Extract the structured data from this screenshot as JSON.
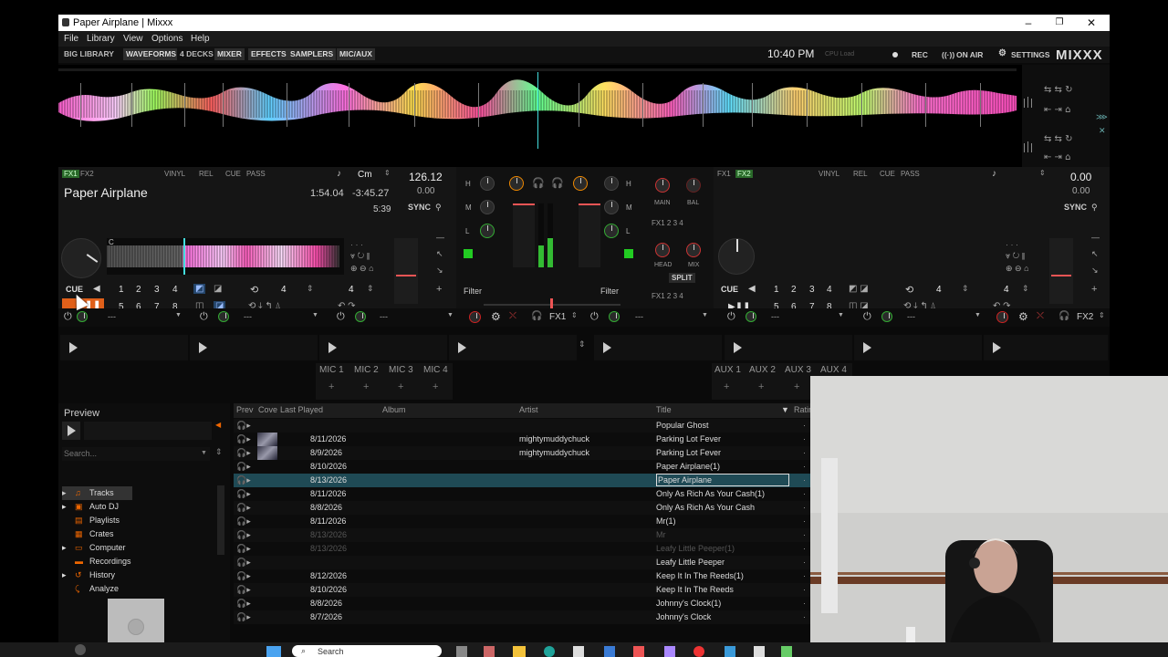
{
  "window": {
    "title": "Paper Airplane | Mixxx",
    "minimize": "–",
    "maximize": "❐",
    "close": "✕"
  },
  "menu": [
    "File",
    "Library",
    "View",
    "Options",
    "Help"
  ],
  "topbar": {
    "buttons": [
      "BIG LIBRARY",
      "WAVEFORMS",
      "4 DECKS",
      "MIXER",
      "EFFECTS",
      "SAMPLERS",
      "MIC/AUX"
    ],
    "clock": "10:40 PM",
    "cpu": "CPU Load",
    "rec": "REC",
    "on_air": "ON AIR",
    "settings": "SETTINGS",
    "logo": "MIXXX"
  },
  "deck1": {
    "fx1": "FX1",
    "fx2": "FX2",
    "vinyl": "VINYL",
    "rel": "REL",
    "cue_mode": "CUE",
    "pass": "PASS",
    "key": "Cm",
    "title": "Paper Airplane",
    "bpm": "126.12",
    "rate": "0.00",
    "elapsed": "1:54.04",
    "remaining": "-3:45.27",
    "duration": "5:39",
    "sync": "SYNC",
    "cue": "CUE",
    "hotcues": [
      "1",
      "2",
      "3",
      "4",
      "5",
      "6",
      "7",
      "8"
    ],
    "loop_size": "4",
    "beatjump": "4",
    "marker": "C"
  },
  "deck2": {
    "fx1": "FX1",
    "fx2": "FX2",
    "vinyl": "VINYL",
    "rel": "REL",
    "cue_mode": "CUE",
    "pass": "PASS",
    "bpm": "0.00",
    "rate": "0.00",
    "sync": "SYNC",
    "cue": "CUE",
    "hotcues": [
      "1",
      "2",
      "3",
      "4",
      "5",
      "6",
      "7",
      "8"
    ],
    "loop_size": "4",
    "beatjump": "4"
  },
  "mixer": {
    "eq": [
      "H",
      "M",
      "L"
    ],
    "filter": "Filter",
    "main": "MAIN",
    "bal": "BAL",
    "head": "HEAD",
    "mix": "MIX",
    "split": "SPLIT",
    "fx_units": [
      "FX1",
      "2",
      "3",
      "4"
    ]
  },
  "effects": {
    "unit1": "FX1",
    "unit2": "FX2",
    "slot_value": "---"
  },
  "mics": [
    "MIC 1",
    "MIC 2",
    "MIC 3",
    "MIC 4"
  ],
  "aux": [
    "AUX 1",
    "AUX 2",
    "AUX 3",
    "AUX 4"
  ],
  "library": {
    "preview": "Preview",
    "search_placeholder": "Search...",
    "tree": [
      {
        "label": "Tracks",
        "selected": true
      },
      {
        "label": "Auto DJ"
      },
      {
        "label": "Playlists"
      },
      {
        "label": "Crates"
      },
      {
        "label": "Computer"
      },
      {
        "label": "Recordings"
      },
      {
        "label": "History"
      },
      {
        "label": "Analyze"
      }
    ],
    "columns": [
      "Prev",
      "Cove",
      "Last Played",
      "Album",
      "Artist",
      "Title",
      "Ratin"
    ],
    "rows": [
      {
        "last_played": "",
        "artist": "",
        "title": "Popular Ghost"
      },
      {
        "last_played": "8/11/2026",
        "artist": "mightymuddychuck",
        "title": "Parking Lot Fever"
      },
      {
        "last_played": "8/9/2026",
        "artist": "mightymuddychuck",
        "title": "Parking Lot Fever"
      },
      {
        "last_played": "8/10/2026",
        "artist": "",
        "title": "Paper Airplane(1)"
      },
      {
        "last_played": "8/13/2026",
        "artist": "",
        "title": "Paper Airplane",
        "selected": true
      },
      {
        "last_played": "8/11/2026",
        "artist": "",
        "title": "Only As Rich As Your Cash(1)"
      },
      {
        "last_played": "8/8/2026",
        "artist": "",
        "title": "Only As Rich As Your Cash"
      },
      {
        "last_played": "8/11/2026",
        "artist": "",
        "title": "Mr(1)"
      },
      {
        "last_played": "8/13/2026",
        "artist": "",
        "title": "Mr",
        "missing": true
      },
      {
        "last_played": "8/13/2026",
        "artist": "",
        "title": "Leafy Little Peeper(1)",
        "missing": true
      },
      {
        "last_played": "",
        "artist": "",
        "title": "Leafy Little Peeper"
      },
      {
        "last_played": "8/12/2026",
        "artist": "",
        "title": "Keep It In The Reeds(1)"
      },
      {
        "last_played": "8/10/2026",
        "artist": "",
        "title": "Keep It In The Reeds"
      },
      {
        "last_played": "8/8/2026",
        "artist": "",
        "title": "Johnny's Clock(1)"
      },
      {
        "last_played": "8/7/2026",
        "artist": "",
        "title": "Johnny's Clock"
      }
    ]
  },
  "taskbar": {
    "search": "Search"
  }
}
